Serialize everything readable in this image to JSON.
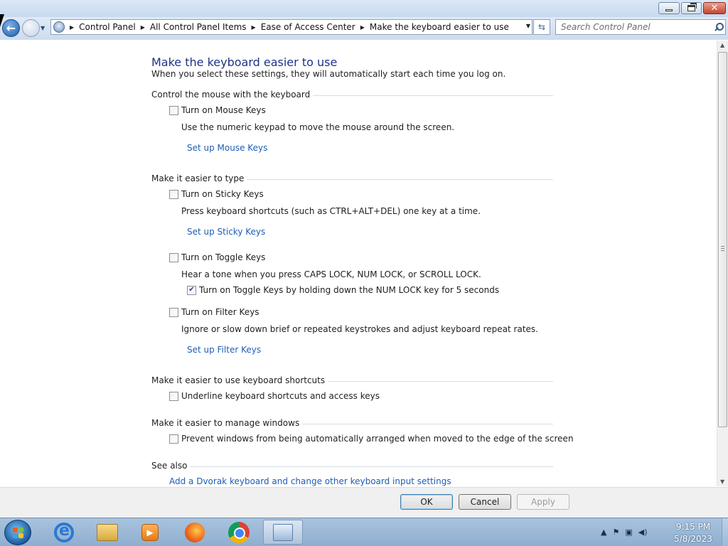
{
  "window": {
    "minimize_icon": "minimize-icon",
    "maximize_icon": "restore-icon",
    "close_label": "✕"
  },
  "nav": {
    "breadcrumb": [
      "Control Panel",
      "All Control Panel Items",
      "Ease of Access Center",
      "Make the keyboard easier to use"
    ],
    "search_placeholder": "Search Control Panel"
  },
  "page": {
    "title": "Make the keyboard easier to use",
    "subtitle": "When you select these settings, they will automatically start each time you log on."
  },
  "sections": {
    "mouse": {
      "heading": "Control the mouse with the keyboard",
      "mouse_keys_label": "Turn on Mouse Keys",
      "mouse_keys_checked": false,
      "mouse_keys_desc": "Use the numeric keypad to move the mouse around the screen.",
      "mouse_keys_link": "Set up Mouse Keys"
    },
    "type": {
      "heading": "Make it easier to type",
      "sticky_label": "Turn on Sticky Keys",
      "sticky_checked": false,
      "sticky_desc": "Press keyboard shortcuts (such as CTRL+ALT+DEL) one key at a time.",
      "sticky_link": "Set up Sticky Keys",
      "toggle_label": "Turn on Toggle Keys",
      "toggle_checked": false,
      "toggle_desc": "Hear a tone when you press CAPS LOCK, NUM LOCK, or SCROLL LOCK.",
      "toggle_hold_label": "Turn on Toggle Keys by holding down the NUM LOCK key for 5 seconds",
      "toggle_hold_checked": true,
      "filter_label": "Turn on Filter Keys",
      "filter_checked": false,
      "filter_desc": "Ignore or slow down brief or repeated keystrokes and adjust keyboard repeat rates.",
      "filter_link": "Set up Filter Keys"
    },
    "shortcuts": {
      "heading": "Make it easier to use keyboard shortcuts",
      "underline_label": "Underline keyboard shortcuts and access keys",
      "underline_checked": false
    },
    "windows": {
      "heading": "Make it easier to manage windows",
      "prevent_label": "Prevent windows from being automatically arranged when moved to the edge of the screen",
      "prevent_checked": false
    },
    "see_also": {
      "heading": "See also",
      "dvorak_link": "Add a Dvorak keyboard and change other keyboard input settings"
    }
  },
  "buttons": {
    "ok": "OK",
    "cancel": "Cancel",
    "apply": "Apply",
    "apply_enabled": false
  },
  "taskbar": {
    "apps": [
      "internet-explorer",
      "windows-explorer",
      "media-player",
      "firefox",
      "chrome",
      "control-panel"
    ],
    "active_app": "control-panel",
    "time": "9:15 PM",
    "date": "5/8/2023"
  },
  "colors": {
    "title_blue": "#1e3287",
    "link_blue": "#1e5cb3"
  }
}
